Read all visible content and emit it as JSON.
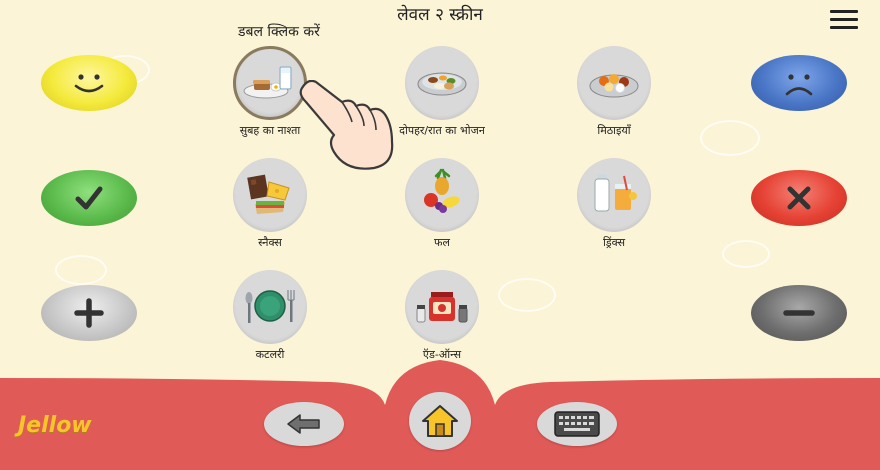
{
  "header": {
    "title": "लेवल २ स्क्रीन",
    "hint": "डबल क्लिक करें",
    "menu_icon": "hamburger-menu-icon"
  },
  "categories": [
    {
      "label": "सुबह का नाश्ता",
      "icon": "breakfast-icon",
      "selected": true
    },
    {
      "label": "दोपहर/रात का भोजन",
      "icon": "lunch-dinner-icon",
      "selected": false
    },
    {
      "label": "मिठाइयाँ",
      "icon": "sweets-icon",
      "selected": false
    },
    {
      "label": "स्नैक्स",
      "icon": "snacks-icon",
      "selected": false
    },
    {
      "label": "फल",
      "icon": "fruits-icon",
      "selected": false
    },
    {
      "label": "ड्रिंक्स",
      "icon": "drinks-icon",
      "selected": false
    },
    {
      "label": "कटलरी",
      "icon": "cutlery-icon",
      "selected": false
    },
    {
      "label": "ऍड-ऑन्स",
      "icon": "add-ons-icon",
      "selected": false
    }
  ],
  "expressive_buttons": {
    "left": [
      "like-smiley-icon",
      "yes-check-icon",
      "more-plus-icon"
    ],
    "right": [
      "dislike-sad-icon",
      "no-cross-icon",
      "less-minus-icon"
    ]
  },
  "footer": {
    "logo_text": "Jellow",
    "back_icon": "back-arrow-icon",
    "home_icon": "home-icon",
    "keyboard_icon": "keyboard-icon"
  },
  "colors": {
    "background": "#fbf4d6",
    "footer": "#e05a57",
    "like": "#f4ea3c",
    "yes": "#5cbb4c",
    "more": "#c8c8c8",
    "dislike": "#4a76c6",
    "no": "#e54234",
    "less": "#6e6e6e",
    "logo": "#f7c52a"
  }
}
